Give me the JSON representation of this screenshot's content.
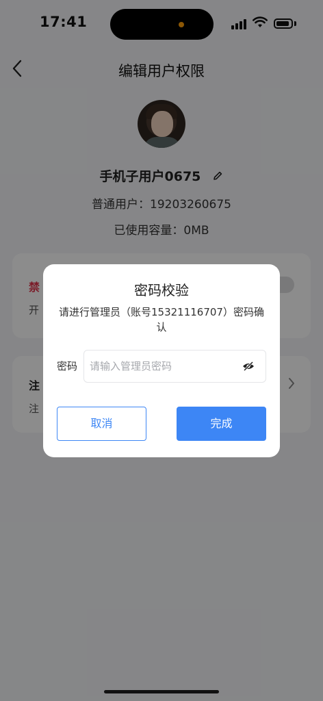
{
  "status_bar": {
    "time": "17:41"
  },
  "nav": {
    "title": "编辑用户权限"
  },
  "profile": {
    "username": "手机子用户0675",
    "user_type": "普通用户：19203260675",
    "capacity": "已使用容量：0MB"
  },
  "cards": {
    "card1_title": "禁",
    "card1_desc": "开",
    "card2_title": "注",
    "card2_desc": "注"
  },
  "dialog": {
    "title": "密码校验",
    "message": "请进行管理员（账号15321116707）密码确认",
    "password_label": "密码",
    "password_placeholder": "请输入管理员密码",
    "password_value": "",
    "cancel_label": "取消",
    "confirm_label": "完成"
  },
  "colors": {
    "accent": "#3d86f5",
    "danger": "#e0334c",
    "overlay": "rgba(0,0,0,0.45)"
  },
  "icons": [
    "back-icon",
    "edit-icon",
    "chevron-right-icon",
    "eye-off-icon",
    "signal-icon",
    "wifi-icon",
    "battery-icon"
  ]
}
